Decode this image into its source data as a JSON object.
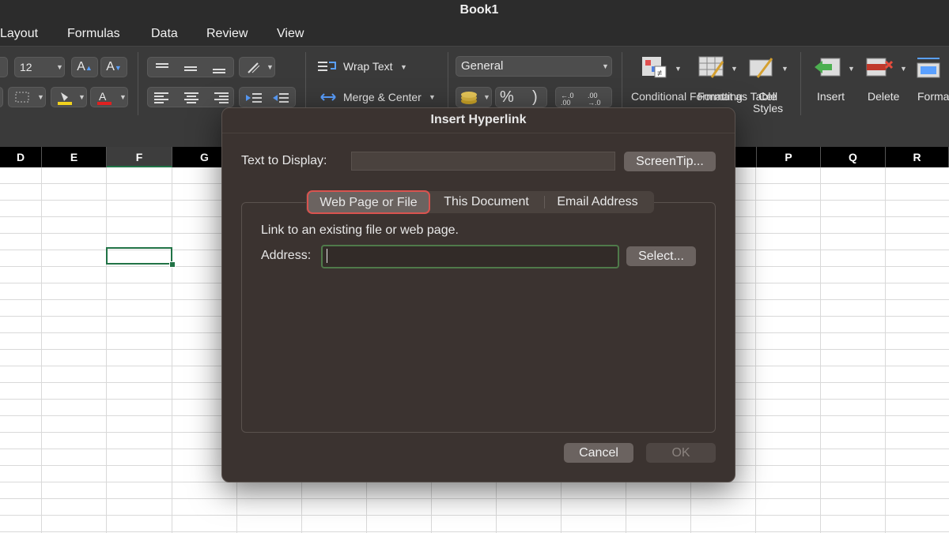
{
  "window": {
    "title": "Book1"
  },
  "menu": {
    "items": [
      "Layout",
      "Formulas",
      "Data",
      "Review",
      "View"
    ]
  },
  "ribbon": {
    "font_size": "12",
    "increase_font": "A",
    "decrease_font": "A",
    "wrap_text": "Wrap Text",
    "merge_center": "Merge & Center",
    "number_format": "General",
    "percent": "%",
    "comma": ")",
    "increase_decimal": "←.0 .00",
    "decrease_decimal": ".00 →.0",
    "conditional_formatting": "Conditional Formatting",
    "format_as_table": "Format as Table",
    "cell_styles_line1": "Cell",
    "cell_styles_line2": "Styles",
    "insert": "Insert",
    "delete": "Delete",
    "format": "Format"
  },
  "sheet": {
    "columns": [
      "D",
      "E",
      "F",
      "G",
      "P",
      "Q",
      "R"
    ],
    "selected_column": "F"
  },
  "dialog": {
    "title": "Insert Hyperlink",
    "text_to_display_label": "Text to Display:",
    "text_to_display_value": "",
    "screentip_button": "ScreenTip...",
    "tabs": [
      "Web Page or File",
      "This Document",
      "Email Address"
    ],
    "active_tab": "Web Page or File",
    "description": "Link to an existing file or web page.",
    "address_label": "Address:",
    "address_value": "",
    "select_button": "Select...",
    "cancel_button": "Cancel",
    "ok_button": "OK",
    "colors": {
      "background": "#3b3330",
      "active_tab_outline": "#d9534f",
      "address_focus": "#4f7a4a"
    }
  }
}
